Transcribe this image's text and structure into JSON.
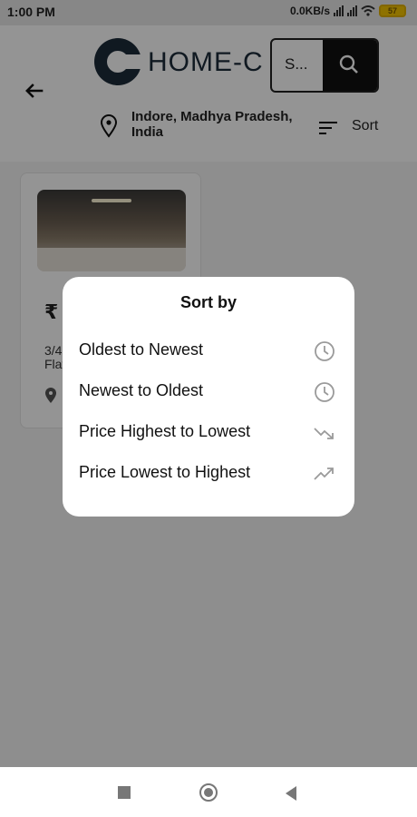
{
  "status_bar": {
    "time": "1:00 PM",
    "net_speed": "0.0KB/s",
    "battery": "57"
  },
  "header": {
    "logo_text": "HOME-C",
    "search": {
      "value": "S..."
    },
    "location": "Indore, Madhya Pradesh, India",
    "sort_label": "Sort"
  },
  "listing": {
    "price_symbol": "₹",
    "desc_line1": "3/4",
    "desc_line2": "Flat"
  },
  "sort_dialog": {
    "title": "Sort by",
    "options": [
      {
        "label": "Oldest to Newest",
        "icon": "clock-icon"
      },
      {
        "label": "Newest to Oldest",
        "icon": "clock-icon"
      },
      {
        "label": "Price Highest to Lowest",
        "icon": "trending-down-icon"
      },
      {
        "label": "Price Lowest to Highest",
        "icon": "trending-up-icon"
      }
    ]
  },
  "colors": {
    "brand": "#1d2b3a",
    "scrim": "rgba(0,0,0,0.42)",
    "icon_gray": "#9a9a9a"
  }
}
